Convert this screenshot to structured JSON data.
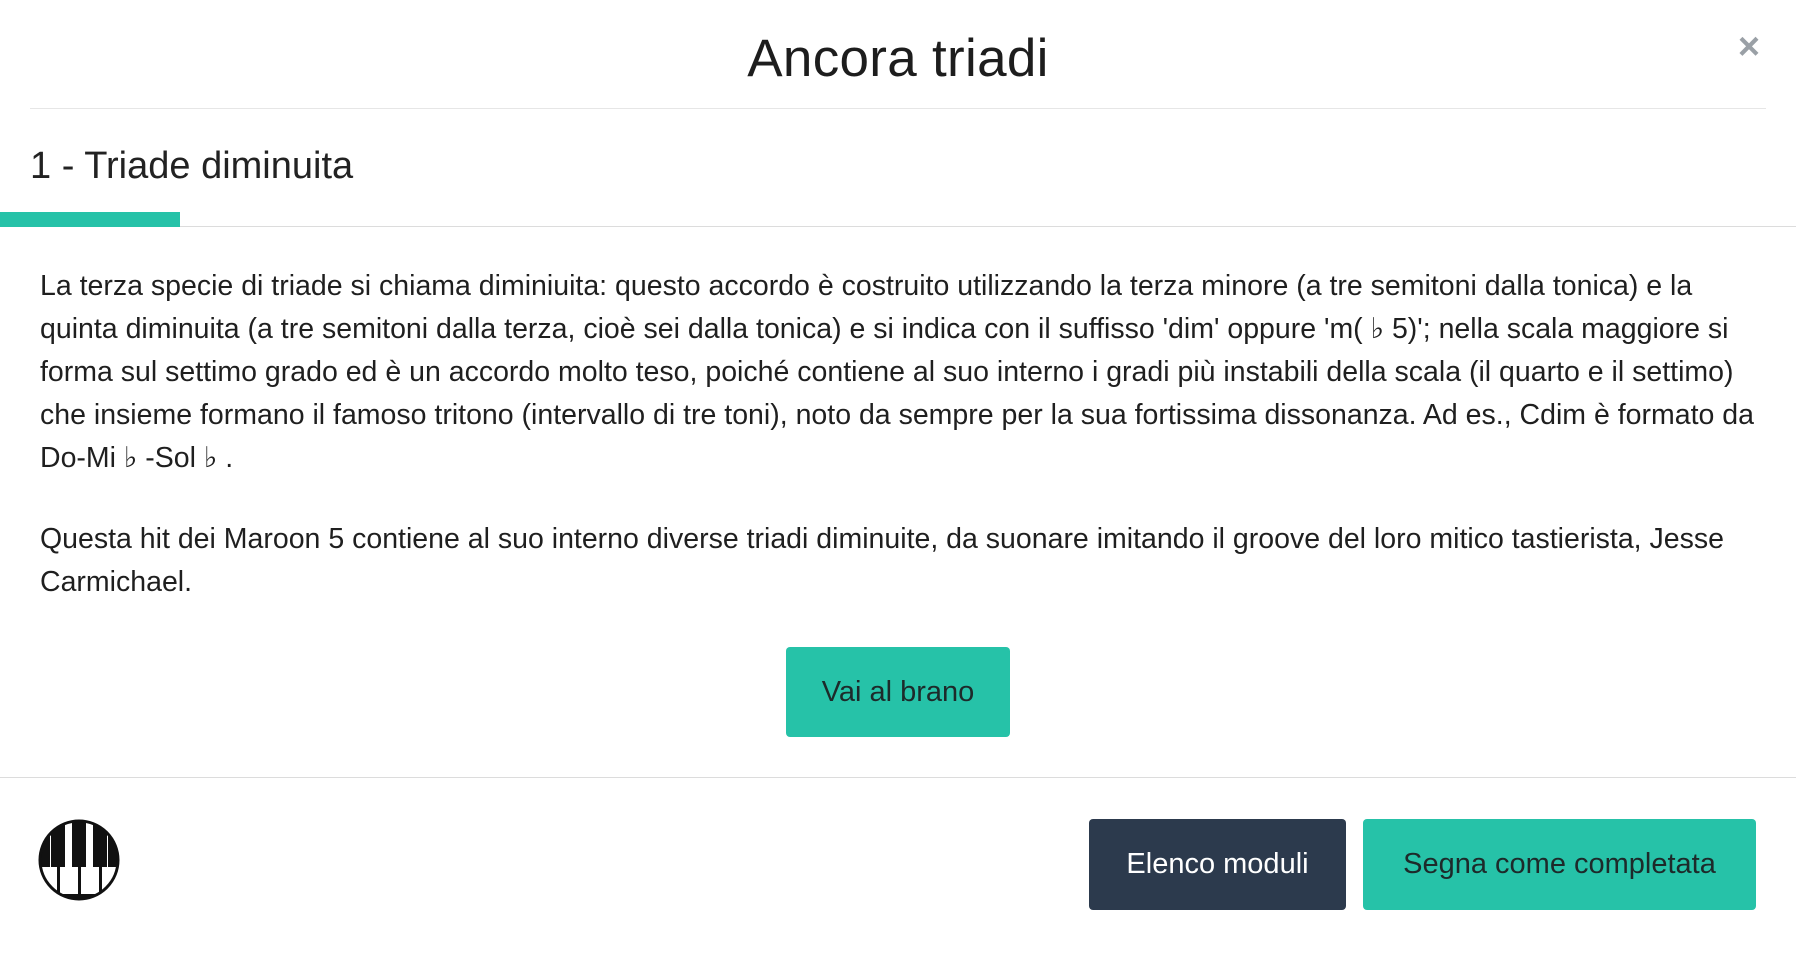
{
  "modal": {
    "title": "Ancora triadi",
    "close_label": "×"
  },
  "section": {
    "title": "1 - Triade diminuita"
  },
  "content": {
    "paragraphs": [
      "La terza specie di triade si chiama diminiuita: questo accordo è costruito utilizzando la terza minore (a tre semitoni dalla tonica) e la quinta diminuita (a tre semitoni dalla terza, cioè sei dalla tonica) e si indica con il suffisso 'dim' oppure 'm( ♭ 5)'; nella scala maggiore si forma sul settimo grado ed è un accordo molto teso, poiché contiene al suo interno i gradi più instabili della scala (il quarto e il settimo) che insieme formano il famoso tritono (intervallo di tre toni), noto da sempre per la sua fortissima dissonanza. Ad es., Cdim è formato da Do-Mi ♭ -Sol ♭ .",
      "Questa hit dei Maroon 5 contiene al suo interno diverse triadi diminuite, da suonare imitando il groove del loro mitico tastierista, Jesse Carmichael."
    ],
    "cta_label": "Vai al brano"
  },
  "footer": {
    "logo_icon": "piano-keys-icon",
    "modules_label": "Elenco moduli",
    "complete_label": "Segna come completata"
  },
  "colors": {
    "accent": "#26c2a8",
    "dark_button": "#2c3a4d"
  }
}
